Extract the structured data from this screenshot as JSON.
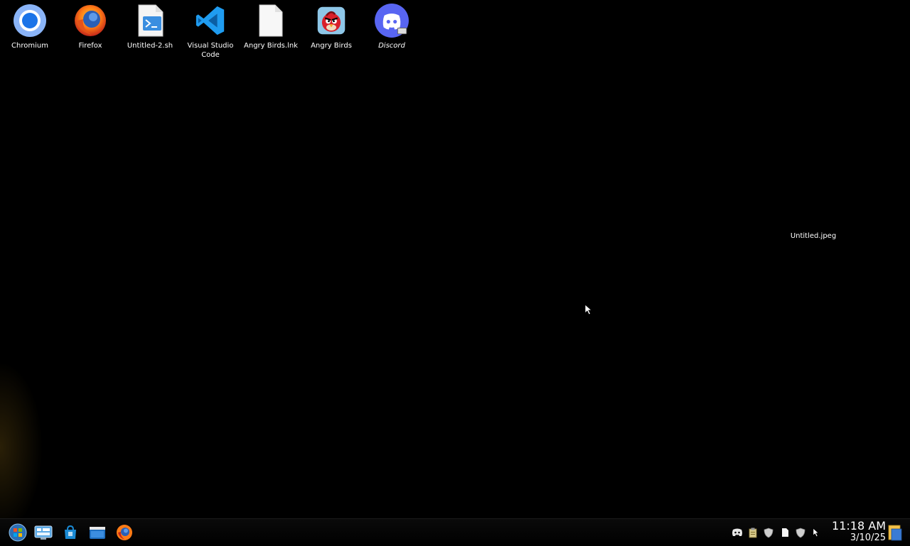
{
  "desktop_icons": [
    {
      "label": "Chromium",
      "icon": "chromium-icon"
    },
    {
      "label": "Firefox",
      "icon": "firefox-icon"
    },
    {
      "label": "Untitled-2.sh",
      "icon": "shell-script-icon"
    },
    {
      "label": "Visual Studio Code",
      "icon": "vscode-icon"
    },
    {
      "label": "Angry Birds.lnk",
      "icon": "blank-file-icon"
    },
    {
      "label": "Angry Birds",
      "icon": "angry-birds-icon"
    },
    {
      "label": "Discord",
      "icon": "discord-icon"
    }
  ],
  "desktop_file": {
    "label": "Untitled.jpeg"
  },
  "taskbar": {
    "start": "start-orb-icon",
    "pinned": [
      "control-panel-icon",
      "store-icon",
      "file-manager-icon",
      "firefox-icon"
    ],
    "tray": [
      "discord-icon",
      "clipboard-icon",
      "shield-icon",
      "document-icon",
      "shield-icon",
      "cursor-icon"
    ]
  },
  "clock": {
    "time": "11:18 AM",
    "date": "3/10/25"
  }
}
